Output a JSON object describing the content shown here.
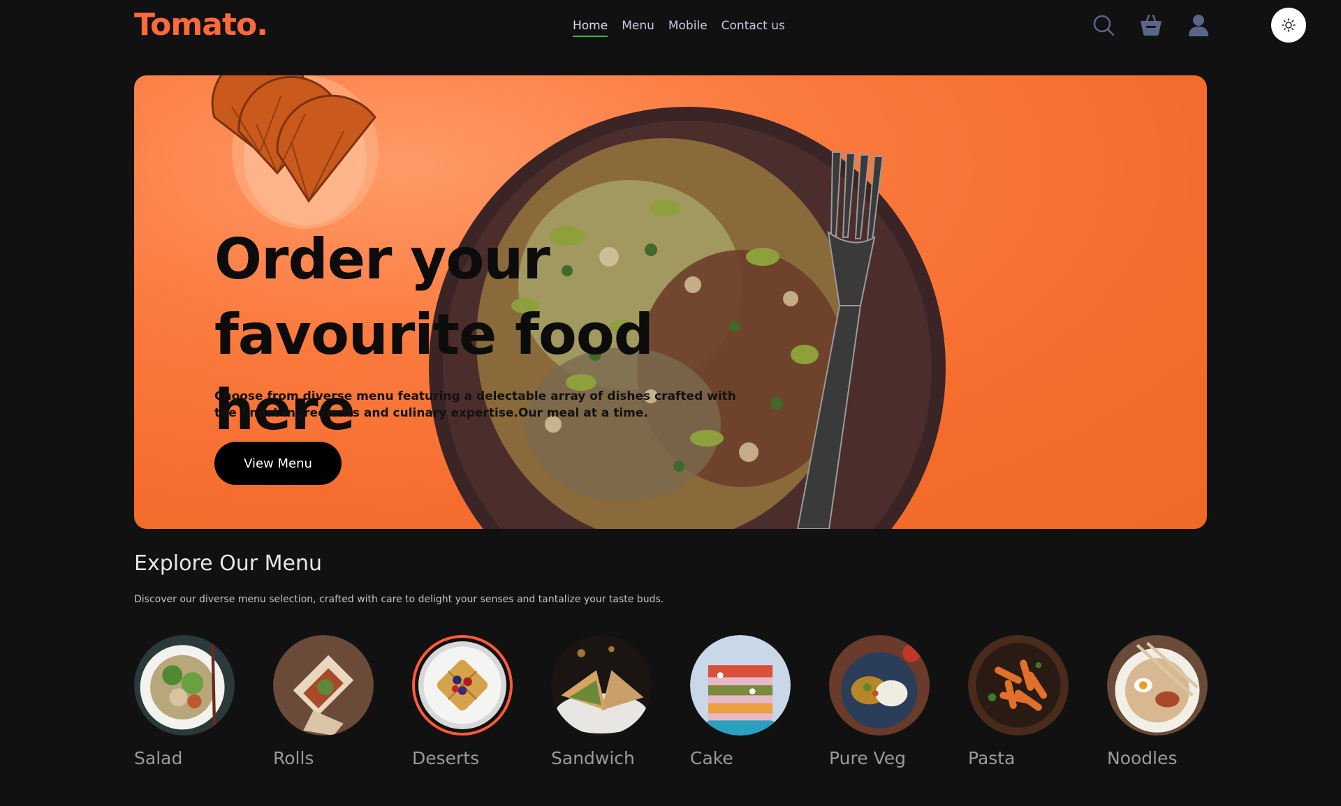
{
  "header": {
    "logo": "Tomato.",
    "nav": [
      "Home",
      "Menu",
      "Mobile",
      "Contact us"
    ],
    "active_nav": "Home",
    "icons": [
      "search-icon",
      "basket-icon",
      "profile-icon",
      "sun-icon"
    ]
  },
  "hero": {
    "title": "Order your favourite food here",
    "description": "Choose from diverse menu featuring a delectable array of dishes crafted with the finest ingredients and culinary expertise.Our meal at a time.",
    "button": "View Menu"
  },
  "explore": {
    "title": "Explore Our Menu",
    "description": "Discover our diverse menu selection, crafted with care to delight your senses and tantalize your taste buds.",
    "items": [
      {
        "label": "Salad"
      },
      {
        "label": "Rolls"
      },
      {
        "label": "Deserts"
      },
      {
        "label": "Sandwich"
      },
      {
        "label": "Cake"
      },
      {
        "label": "Pure Veg"
      },
      {
        "label": "Pasta"
      },
      {
        "label": "Noodles"
      }
    ],
    "selected": "Deserts"
  },
  "colors": {
    "accent": "#ff6a3d",
    "hero_bg": "#f46c2d",
    "active_underline": "#4caf50",
    "selected_ring": "#ff5a3a"
  }
}
